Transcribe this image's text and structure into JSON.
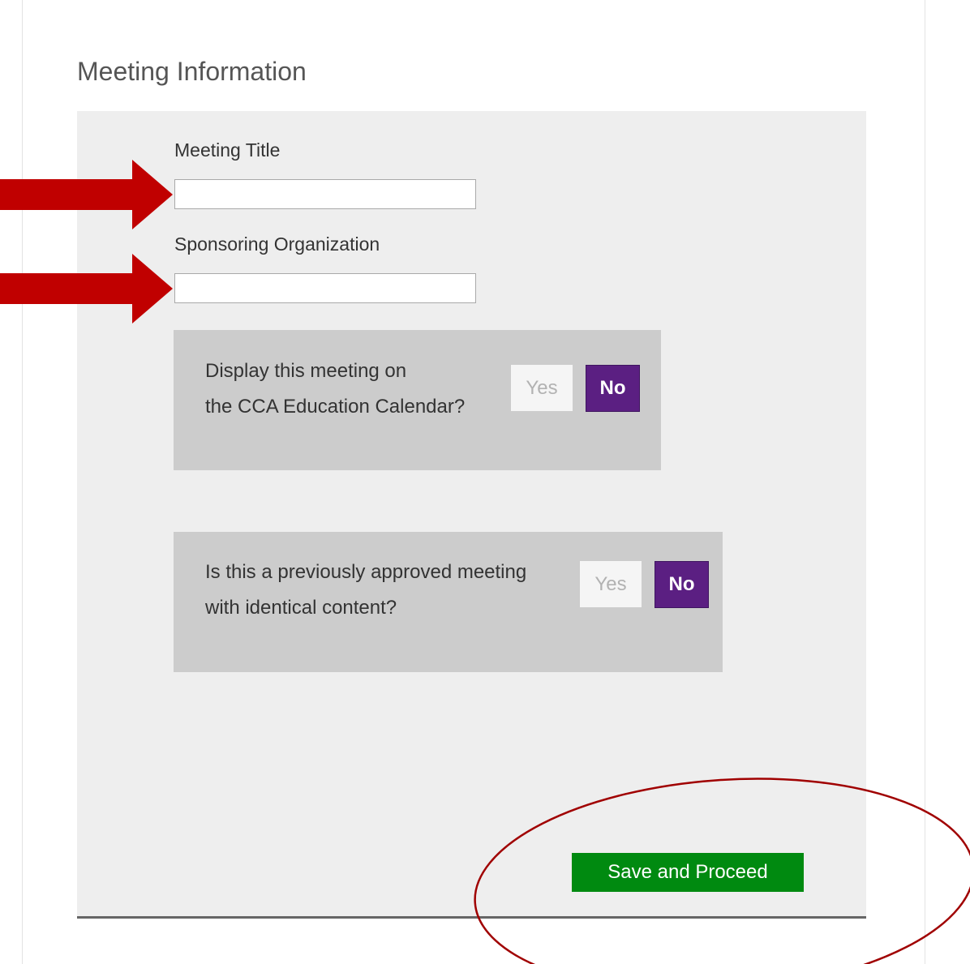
{
  "section": {
    "title": "Meeting Information"
  },
  "fields": {
    "meeting_title": {
      "label": "Meeting Title",
      "value": ""
    },
    "sponsoring_org": {
      "label": "Sponsoring Organization",
      "value": ""
    }
  },
  "questions": {
    "display_calendar": {
      "line1": "Display this meeting on",
      "line2": "the CCA Education Calendar?",
      "yes_label": "Yes",
      "no_label": "No",
      "selected": "No"
    },
    "previously_approved": {
      "line1": "Is this a previously approved meeting",
      "line2": "with identical content?",
      "yes_label": "Yes",
      "no_label": "No",
      "selected": "No"
    }
  },
  "actions": {
    "save_label": "Save and Proceed"
  },
  "colors": {
    "selected_toggle": "#5b1f82",
    "save_button": "#008a10",
    "annotation": "#c00000"
  },
  "annotations": {
    "arrows": [
      "arrow-right-icon",
      "arrow-right-icon"
    ],
    "highlight": "ellipse-highlight"
  }
}
